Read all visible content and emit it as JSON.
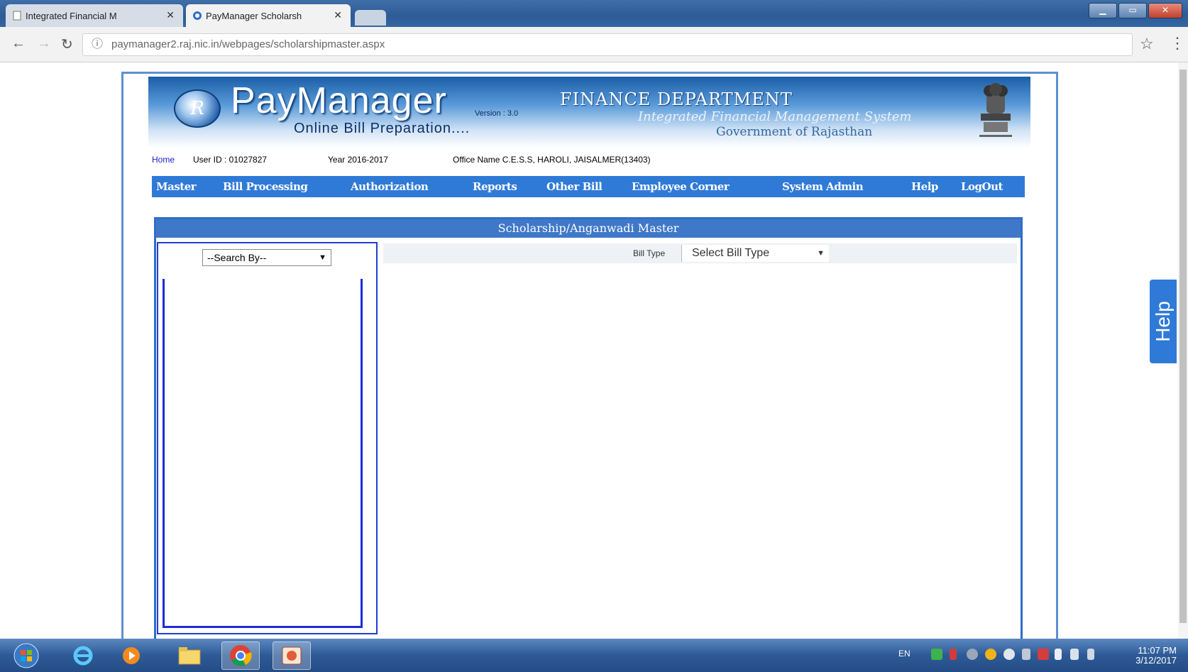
{
  "browser": {
    "tabs": [
      {
        "title": "Integrated Financial M",
        "active": false
      },
      {
        "title": "PayManager Scholarsh",
        "active": true
      }
    ],
    "url": "paymanager2.raj.nic.in/webpages/scholarshipmaster.aspx"
  },
  "header": {
    "brand": "PayManager",
    "version": "Version : 3.0",
    "tagline": "Online Bill Preparation....",
    "department": "FINANCE  DEPARTMENT",
    "dept_sub1": "Integrated Financial Management System",
    "dept_sub2": "Government of Rajasthan"
  },
  "infobar": {
    "home": "Home",
    "login": "User ID : 01027827",
    "year": "Year 2016-2017",
    "office": "Office Name C.E.S.S, HAROLI, JAISALMER(13403)"
  },
  "nav": {
    "items": [
      "Master",
      "Bill Processing",
      "Authorization",
      "Reports",
      "Other Bill",
      "Employee Corner",
      "System Admin",
      "Help",
      "LogOut"
    ]
  },
  "panel": {
    "title": "Scholarship/Anganwadi Master",
    "search_by": "--Search By--",
    "bill_type_label": "Bill Type",
    "bill_type_value": "Select Bill Type"
  },
  "help_tab": "Help",
  "taskbar": {
    "time": "11:07 PM",
    "date": "3/12/2017",
    "lang": "EN"
  },
  "colors": {
    "nav_blue": "#2f7ad6",
    "panel_border": "#2f6ec8",
    "list_border": "#1d2dd8"
  }
}
